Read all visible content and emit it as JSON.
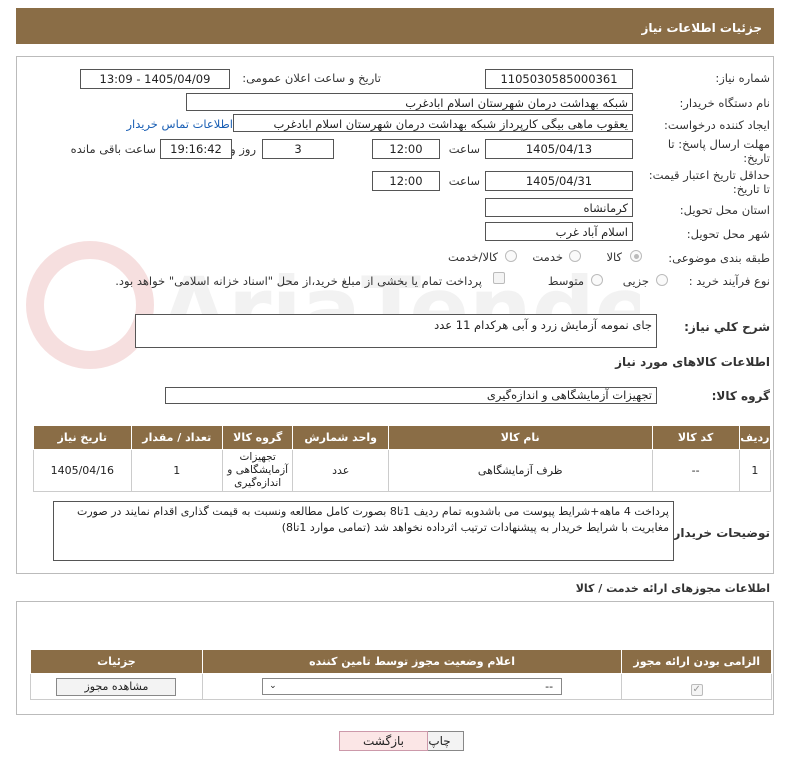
{
  "header": {
    "title": "جزئیات اطلاعات نیاز"
  },
  "form": {
    "need_number_label": "شماره نیاز:",
    "need_number": "1105030585000361",
    "announce_label": "تاریخ و ساعت اعلان عمومی:",
    "announce_value": "1405/04/09 - 13:09",
    "buyer_org_label": "نام دستگاه خریدار:",
    "buyer_org": "شبکه بهداشت درمان شهرستان اسلام ابادغرب",
    "creator_label": "ایجاد کننده درخواست:",
    "creator": "یعقوب ماهی بیگی کارپرداز شبکه بهداشت درمان شهرستان اسلام ابادغرب",
    "contact_link": "اطلاعات تماس خریدار",
    "reply_deadline_label": "مهلت ارسال پاسخ: تا تاریخ:",
    "reply_date": "1405/04/13",
    "time_label": "ساعت",
    "reply_time": "12:00",
    "days_value": "3",
    "days_label": "روز و",
    "remaining_time": "19:16:42",
    "remaining_label": "ساعت باقی مانده",
    "price_validity_label": "حداقل تاریخ اعتبار قیمت: تا تاریخ:",
    "price_date": "1405/04/31",
    "price_time": "12:00",
    "province_label": "استان محل تحویل:",
    "province": "کرمانشاه",
    "city_label": "شهر محل تحویل:",
    "city": "اسلام آباد غرب",
    "category_label": "طبقه بندی موضوعی:",
    "category_options": [
      "کالا",
      "خدمت",
      "کالا/خدمت"
    ],
    "process_label": "نوع فرآیند خرید :",
    "process_options": [
      "جزیی",
      "متوسط"
    ],
    "payment_note": "پرداخت تمام یا بخشی از مبلغ خرید،از محل \"اسناد خزانه اسلامی\" خواهد بود."
  },
  "summary": {
    "label": "شرح کلي نياز:",
    "value": "جای نمومه آزمایش زرد و آبی هرکدام 11 عدد"
  },
  "goods": {
    "section_title": "اطلاعات کالاهای مورد نیاز",
    "group_label": "گروه کالا:",
    "group_value": "تجهیزات آزمایشگاهی و اندازه‌گیری",
    "columns": [
      "ردیف",
      "کد کالا",
      "نام کالا",
      "واحد شمارش",
      "گروه کالا",
      "تعداد / مقدار",
      "تاریخ نیاز"
    ],
    "rows": [
      {
        "idx": "1",
        "code": "--",
        "name": "ظرف آزمایشگاهی",
        "unit": "عدد",
        "group": "تجهیزات آزمایشگاهی و اندازه‌گیری",
        "qty": "1",
        "date": "1405/04/16"
      }
    ]
  },
  "buyer_notes": {
    "label": "توضیحات خریدار:",
    "value": "پرداخت 4 ماهه+شرایط پیوست می باشدوبه تمام ردیف 1تا8 بصورت کامل مطالعه ونسبت به قیمت گذاری اقدام نمایند در صورت مغایریت با شرایط خریدار به پیشنهادات ترتیب اثرداده نخواهد شد (تمامی موارد 1تا8)"
  },
  "permits": {
    "section_title": "اطلاعات مجوزهای ارائه خدمت / کالا",
    "columns": [
      "الزامی بودن ارائه مجوز",
      "اعلام وضعیت مجوز توسط تامین کننده",
      "جزئیات"
    ],
    "select_value": "--",
    "view_button": "مشاهده مجوز"
  },
  "actions": {
    "print": "چاپ",
    "back": "بازگشت"
  },
  "watermark": "AriaTender.net"
}
